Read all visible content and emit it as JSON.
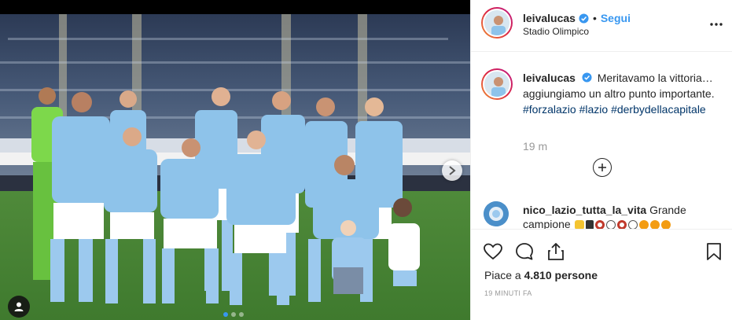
{
  "post": {
    "username": "leivalucas",
    "verified": true,
    "follow_label": "Segui",
    "separator": "•",
    "location": "Stadio Olimpico",
    "caption": {
      "username": "leivalucas",
      "text": "Meritavamo la vittoria… aggiungiamo un altro punto importante.",
      "hashtags": [
        "#forzalazio",
        "#lazio",
        "#derbydellacapitale"
      ]
    },
    "time_ago": "19 m",
    "comments": [
      {
        "username": "nico_lazio_tutta_la_vita",
        "text": "Grande campione"
      }
    ],
    "likes_prefix": "Piace a ",
    "likes_count": "4.810",
    "likes_suffix": " persone",
    "timestamp": "19 MINUTI FA",
    "carousel": {
      "total": 3,
      "active": 0
    }
  },
  "icons": {
    "verified": "verified-badge-icon",
    "more": "more-options-icon",
    "plus": "load-more-comments-icon",
    "like": "heart-icon",
    "comment": "comment-icon",
    "share": "share-icon",
    "save": "bookmark-icon",
    "next": "chevron-right-icon",
    "tags": "user-tag-icon"
  },
  "colors": {
    "accent": "#3897f0",
    "hashtag": "#003569",
    "muted": "#999999",
    "kit": "#8ec3ea"
  }
}
